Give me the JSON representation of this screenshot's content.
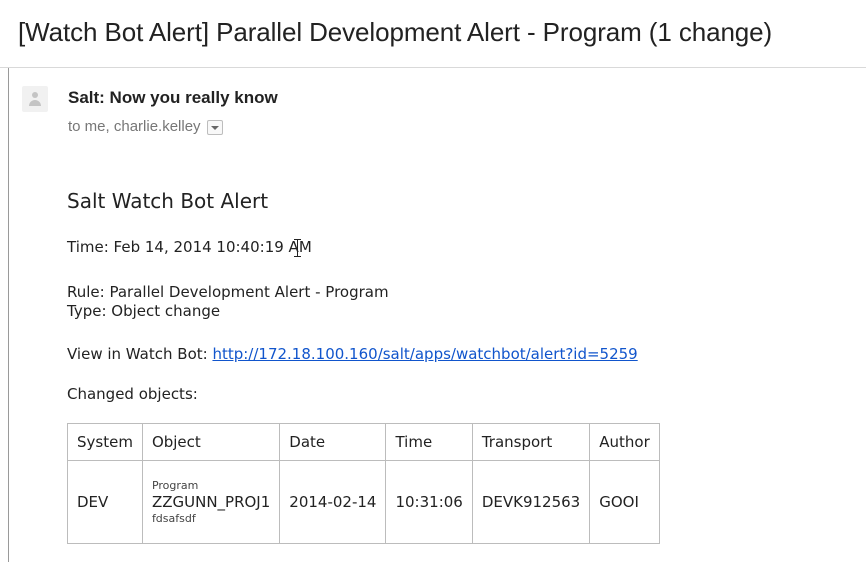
{
  "email": {
    "subject": "[Watch Bot Alert] Parallel Development Alert - Program (1 change)",
    "sender": "Salt: Now you really know",
    "recipients": "to me, charlie.kelley"
  },
  "alert": {
    "heading": "Salt Watch Bot Alert",
    "time_line": "Time: Feb 14, 2014 10:40:19 AM",
    "rule_line": "Rule: Parallel Development Alert - Program",
    "type_line": "Type: Object change",
    "view_label": "View in Watch Bot: ",
    "view_url": "http://172.18.100.160/salt/apps/watchbot/alert?id=5259",
    "changed_label": "Changed objects:"
  },
  "objects_table": {
    "headers": [
      "System",
      "Object",
      "Date",
      "Time",
      "Transport",
      "Author"
    ],
    "rows": [
      {
        "system": "DEV",
        "object_type": "Program",
        "object_name": "ZZGUNN_PROJ1",
        "object_desc": "fdsafsdf",
        "date": "2014-02-14",
        "time": "10:31:06",
        "transport": "DEVK912563",
        "author": "GOOI"
      }
    ]
  },
  "icons": {
    "avatar": "default-avatar-icon",
    "details_toggle": "chevron-down-icon",
    "cursor": "text-cursor-icon"
  },
  "colors": {
    "link": "#1155cc",
    "muted_text": "#777777",
    "border": "#bcbcbc"
  }
}
